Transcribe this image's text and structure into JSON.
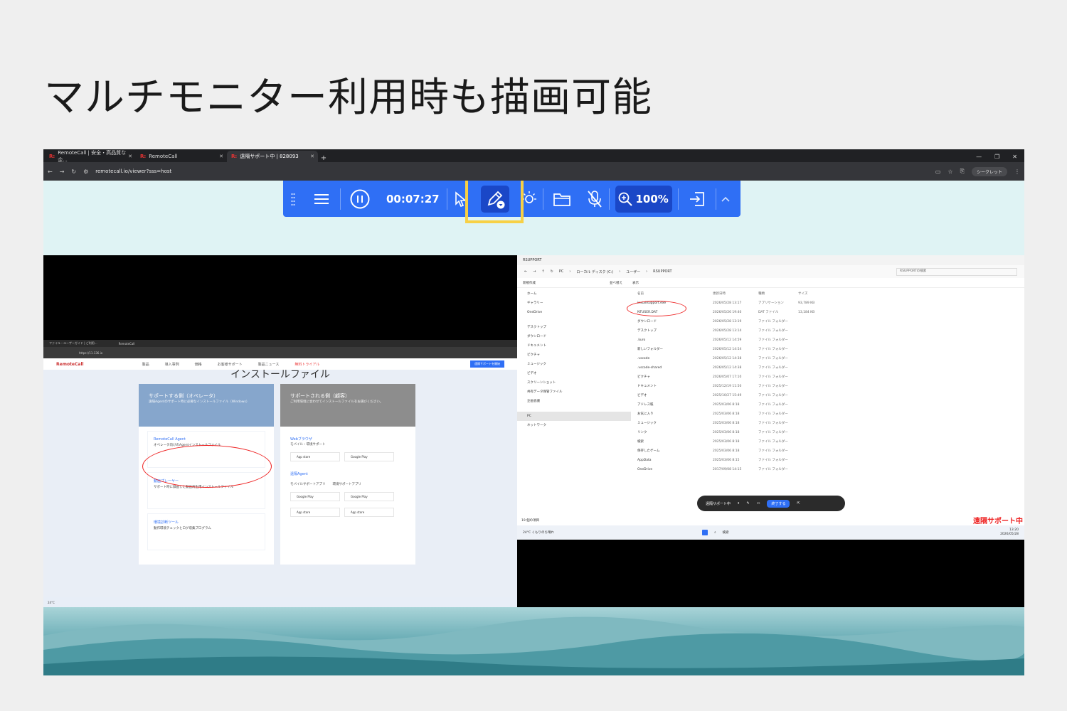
{
  "slide": {
    "title": "マルチモニター利用時も描画可能"
  },
  "browser": {
    "tabs": [
      {
        "label": "RemoteCall | 安全・高品質な企..."
      },
      {
        "label": "RemoteCall"
      },
      {
        "label": "遠隔サポート中 | 828093"
      }
    ],
    "url": "remotecall.io/viewer?sss=host",
    "incognito": "シークレット"
  },
  "toolbar": {
    "timer": "00:07:27",
    "zoom": "100%"
  },
  "left_screen": {
    "inner_tabs": [
      "ファイル・ユーザーガイド | ご利用...",
      "RemoteCall"
    ],
    "inner_url": "https://11.136.io",
    "logo": "RemoteCall",
    "nav": [
      "製品",
      "導入事例",
      "価格",
      "お客様サポート",
      "製品ニュース",
      "無料トライアル"
    ],
    "cta": "遠隔サポートを開始",
    "heading": "インストールファイル",
    "operator_card": {
      "title": "サポートする側（オペレータ）",
      "desc": "遠隔Agentのサポート時に必要なインストールファイル（Windows）",
      "items": [
        {
          "title": "RemoteCall Agent",
          "desc": "オペレータ向けのAgentインストールファイル"
        },
        {
          "title": "動画プレーヤー",
          "desc": "サポート時に録画した動画再生用インストールファイル"
        },
        {
          "title": "環境診断ツール",
          "desc": "動作環境チェックとログ収集プログラム"
        }
      ]
    },
    "customer_card": {
      "title": "サポートされる側（顧客）",
      "desc": "ご利用環境に合わせてインストールファイルをお選びください。",
      "web_title": "Webブラウザ",
      "web_desc": "モバイル・環境サポート",
      "agent_title": "遠隔Agent",
      "mobile_label": "モバイルサポートアプリ",
      "env_label": "環境サポートアプリ",
      "app_store": "App store",
      "google_play": "Google Play"
    },
    "weather": "24°C"
  },
  "right_screen": {
    "window_title": "RSUPPORT",
    "breadcrumb": [
      "PC",
      "ローカル ディスク (C:)",
      "ユーザー",
      "RSUPPORT"
    ],
    "search_placeholder": "RSUPPORTの検索",
    "cmd": [
      "新規作成",
      "並べ替え",
      "表示"
    ],
    "sidebar": [
      "ホーム",
      "ギャラリー",
      "OneDrive",
      "デスクトップ",
      "ダウンロード",
      "ドキュメント",
      "ピクチャ",
      "ミュージック",
      "ビデオ",
      "スクリーンショット",
      "共有データ保管ファイル",
      "企画会議",
      "PC",
      "ネットワーク"
    ],
    "columns": [
      "名前",
      "更新日時",
      "種類",
      "サイズ"
    ],
    "files": [
      {
        "name": "installsupport.exe",
        "date": "2026/05/28 13:17",
        "type": "アプリケーション",
        "size": "93,789 KB"
      },
      {
        "name": "NTUSER.DAT",
        "date": "2026/05/26 19:40",
        "type": "DAT ファイル",
        "size": "13,184 KB"
      },
      {
        "name": "ダウンロード",
        "date": "2026/05/28 13:19",
        "type": "ファイル フォルダー",
        "size": ""
      },
      {
        "name": "デスクトップ",
        "date": "2026/05/28 13:14",
        "type": "ファイル フォルダー",
        "size": ""
      },
      {
        "name": ".kuro",
        "date": "2026/05/12 14:59",
        "type": "ファイル フォルダー",
        "size": ""
      },
      {
        "name": "新しいフォルダー",
        "date": "2026/05/12 14:54",
        "type": "ファイル フォルダー",
        "size": ""
      },
      {
        "name": ".vscode",
        "date": "2026/05/12 14:38",
        "type": "ファイル フォルダー",
        "size": ""
      },
      {
        "name": ".vscode-shared",
        "date": "2026/05/12 14:38",
        "type": "ファイル フォルダー",
        "size": ""
      },
      {
        "name": "ピクチャ",
        "date": "2026/05/07 17:10",
        "type": "ファイル フォルダー",
        "size": ""
      },
      {
        "name": "ドキュメント",
        "date": "2025/12/19 11:50",
        "type": "ファイル フォルダー",
        "size": ""
      },
      {
        "name": "ビデオ",
        "date": "2025/10/27 15:49",
        "type": "ファイル フォルダー",
        "size": ""
      },
      {
        "name": "アドレス帳",
        "date": "2025/03/06 8:18",
        "type": "ファイル フォルダー",
        "size": ""
      },
      {
        "name": "お気に入り",
        "date": "2025/03/06 8:18",
        "type": "ファイル フォルダー",
        "size": ""
      },
      {
        "name": "ミュージック",
        "date": "2025/03/06 8:18",
        "type": "ファイル フォルダー",
        "size": ""
      },
      {
        "name": "リンク",
        "date": "2025/03/06 8:18",
        "type": "ファイル フォルダー",
        "size": ""
      },
      {
        "name": "検索",
        "date": "2025/03/06 8:18",
        "type": "ファイル フォルダー",
        "size": ""
      },
      {
        "name": "保存したゲーム",
        "date": "2025/03/06 8:18",
        "type": "ファイル フォルダー",
        "size": ""
      },
      {
        "name": "AppData",
        "date": "2025/03/06 8:15",
        "type": "ファイル フォルダー",
        "size": ""
      },
      {
        "name": "OneDrive",
        "date": "2017/09/08 14:15",
        "type": "ファイル フォルダー",
        "size": ""
      }
    ],
    "item_count": "19 個の項目",
    "mini_toolbar": {
      "label": "遠隔サポート中",
      "end": "終了する"
    },
    "remote_label": "遠隔サポート中",
    "taskbar": {
      "search": "検索",
      "weather": "24°C",
      "weather_desc": "くもりのち晴れ",
      "time": "13:20",
      "date": "2026/05/28"
    }
  }
}
